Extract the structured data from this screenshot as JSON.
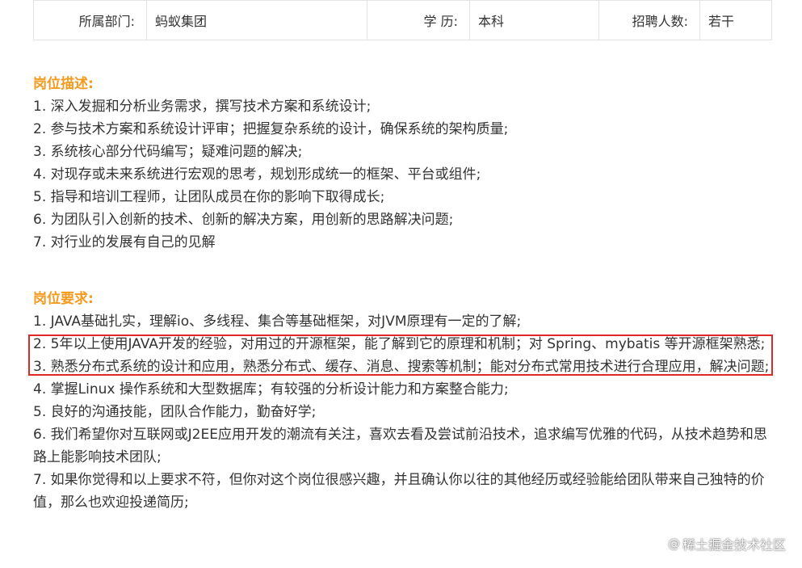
{
  "info_table": {
    "department_label": "所属部门:",
    "department_value": "蚂蚁集团",
    "education_label": "学 历:",
    "education_value": "本科",
    "headcount_label": "招聘人数:",
    "headcount_value": "若干"
  },
  "description": {
    "title": "岗位描述:",
    "items": [
      "1. 深入发掘和分析业务需求，撰写技术方案和系统设计;",
      "2. 参与技术方案和系统设计评审；把握复杂系统的设计，确保系统的架构质量;",
      "3. 系统核心部分代码编写；疑难问题的解决;",
      "4. 对现存或未来系统进行宏观的思考，规划形成统一的框架、平台或组件;",
      "5. 指导和培训工程师，让团队成员在你的影响下取得成长;",
      "6. 为团队引入创新的技术、创新的解决方案，用创新的思路解决问题;",
      "7. 对行业的发展有自己的见解"
    ]
  },
  "requirements": {
    "title": "岗位要求:",
    "items": [
      "1. JAVA基础扎实，理解io、多线程、集合等基础框架，对JVM原理有一定的了解;",
      "2. 5年以上使用JAVA开发的经验，对用过的开源框架，能了解到它的原理和机制；对 Spring、mybatis 等开源框架熟悉;",
      "3. 熟悉分布式系统的设计和应用，熟悉分布式、缓存、消息、搜索等机制；能对分布式常用技术进行合理应用，解决问题;",
      "4. 掌握Linux 操作系统和大型数据库；有较强的分析设计能力和方案整合能力;",
      "5. 良好的沟通技能，团队合作能力，勤奋好学;",
      "6. 我们希望你对互联网或J2EE应用开发的潮流有关注，喜欢去看及尝试前沿技术，追求编写优雅的代码，从技术趋势和思路上能影响技术团队;",
      "7. 如果你觉得和以上要求不符，但你对这个岗位很感兴趣，并且确认你以往的其他经历或经验能给团队带来自己独特的价值，那么也欢迎投递简历;"
    ]
  },
  "watermark": {
    "at": "@",
    "text": "稀土掘金技术社区"
  },
  "colors": {
    "section_title": "#f39a1f",
    "highlight_border": "#e02828",
    "text": "#333333",
    "table_border": "#e4e4e4"
  }
}
